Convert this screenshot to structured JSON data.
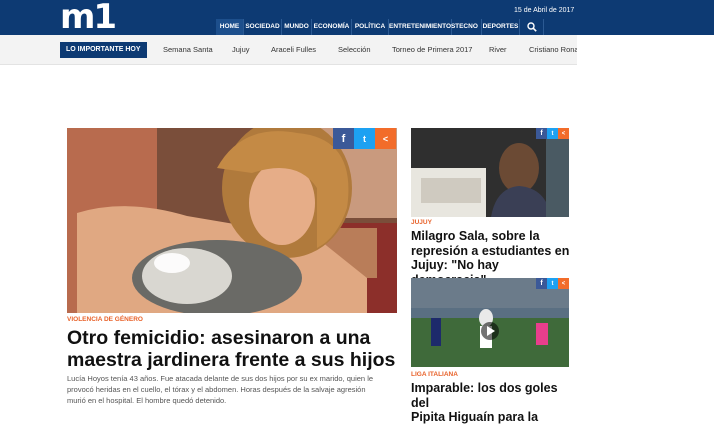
{
  "header": {
    "logo": "m1",
    "date": "15 de Abril de 2017",
    "nav": [
      "HOME",
      "SOCIEDAD",
      "MUNDO",
      "ECONOMÍA",
      "POLÍTICA",
      "ENTRETENIMIENTOS",
      "TECNO",
      "DEPORTES"
    ]
  },
  "subnav": {
    "label": "LO IMPORTANTE HOY",
    "topics": [
      "Semana Santa",
      "Jujuy",
      "Araceli Fulles",
      "Selección",
      "Torneo de Primera 2017",
      "River",
      "Cristiano Ronal"
    ]
  },
  "main_story": {
    "kicker": "VIOLENCIA DE GÉNERO",
    "headline_line1": "Otro femicidio: asesinaron a una",
    "headline_line2": "maestra jardinera frente a sus hijos",
    "summary_line1": "Lucía Hoyos tenía 43 años. Fue atacada delante de sus dos hijos por su ex marido, quien le",
    "summary_line2": "provocó heridas en el cuello, el tórax y el abdomen. Horas después de la salvaje agresión",
    "summary_line3": "murió en el hospital. El hombre quedó detenido."
  },
  "side_story_1": {
    "kicker": "JUJUY",
    "line1": "Milagro Sala, sobre la",
    "line2": "represión a estudiantes en",
    "line3": "Jujuy: \"No hay democracia\""
  },
  "side_story_2": {
    "kicker": "LIGA ITALIANA",
    "line1": "Imparable: los dos goles del",
    "line2": "Pipita Higuaín para la"
  },
  "share_icons": [
    "facebook-icon",
    "twitter-icon",
    "share-icon"
  ],
  "colors": {
    "navy": "#0d3a73",
    "accent": "#e8622a",
    "facebook": "#3b5998",
    "twitter": "#1da1f2"
  }
}
